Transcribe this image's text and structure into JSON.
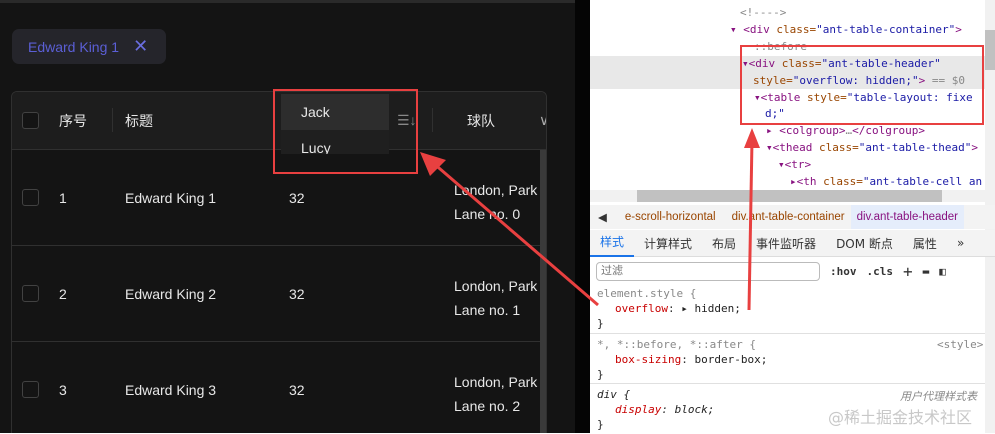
{
  "tag": {
    "label": "Edward King 1",
    "close": "✕"
  },
  "table": {
    "headers": {
      "index": "序号",
      "title": "标题",
      "sort_icon": "☰↓",
      "team": "球队",
      "chevron": "∨"
    },
    "rows": [
      {
        "index": "1",
        "title": "Edward King 1",
        "age": "32",
        "addr1": "London, Park",
        "addr2": "Lane no. 0"
      },
      {
        "index": "2",
        "title": "Edward King 2",
        "age": "32",
        "addr1": "London, Park",
        "addr2": "Lane no. 1"
      },
      {
        "index": "3",
        "title": "Edward King 3",
        "age": "32",
        "addr1": "London, Park",
        "addr2": "Lane no. 2"
      }
    ]
  },
  "dropdown": {
    "options": [
      "Jack",
      "Lucy"
    ]
  },
  "devtools": {
    "dom": {
      "comment": "<!---->",
      "container_open": "<div ",
      "cls": "class=",
      "container_val": "\"ant-table-container\"",
      ">": ">",
      "before": "::before",
      "header_val": "\"ant-table-header\"",
      "style_attr": "style=",
      "style_val": "\"overflow: hidden;\"",
      "eq": "== $0",
      "table_open": "<table ",
      "table_style": "\"table-layout: fixe",
      "table_style2": "d;\"",
      "colgroup": "<colgroup>",
      "ellipsis": "…",
      "colgroup_close": "</colgroup>",
      "thead": "<thead ",
      "thead_val": "\"ant-table-thead\"",
      "tr": "<tr>",
      "th": "<th ",
      "th_val": "\"ant-table-cell an"
    },
    "breadcrumbs": [
      "e-scroll-horizontal",
      "div.ant-table-container",
      "div.ant-table-header"
    ],
    "tabs": [
      "样式",
      "计算样式",
      "布局",
      "事件监听器",
      "DOM 断点",
      "属性",
      "»"
    ],
    "filter_placeholder": "过滤",
    "hov": ":hov",
    "cls": ".cls",
    "plus": "+",
    "rules": [
      {
        "selector": "element.style {",
        "prop": "overflow",
        "value": "▸ hidden;",
        "close": "}"
      },
      {
        "selector": "*, *::before, *::after {",
        "source": "<style>",
        "prop": "box-sizing",
        "value": "border-box;",
        "close": "}"
      },
      {
        "selector": "div {",
        "source": "用户代理样式表",
        "prop": "display",
        "value": "block;",
        "close": "}"
      }
    ]
  },
  "watermark": "@稀土掘金技术社区"
}
